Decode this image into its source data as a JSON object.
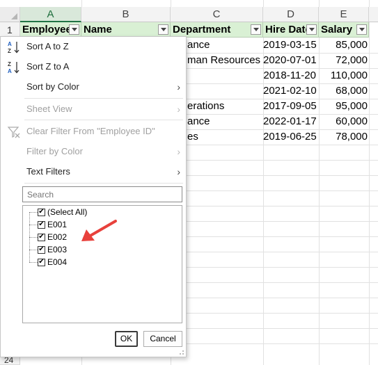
{
  "columns": [
    "A",
    "B",
    "C",
    "D",
    "E"
  ],
  "row_numbers": [
    "1",
    "24"
  ],
  "headers": {
    "employee_id": "Employee I",
    "name": "Name",
    "department": "Department",
    "hire_date": "Hire Date",
    "salary": "Salary"
  },
  "rows": [
    {
      "dept": "ance",
      "date": "2019-03-15",
      "salary": "85,000"
    },
    {
      "dept": "man Resources",
      "date": "2020-07-01",
      "salary": "72,000"
    },
    {
      "dept": "",
      "date": "2018-11-20",
      "salary": "110,000"
    },
    {
      "dept": "",
      "date": "2021-02-10",
      "salary": "68,000"
    },
    {
      "dept": "erations",
      "date": "2017-09-05",
      "salary": "95,000"
    },
    {
      "dept": "ance",
      "date": "2022-01-17",
      "salary": "60,000"
    },
    {
      "dept": "es",
      "date": "2019-06-25",
      "salary": "78,000"
    }
  ],
  "menu": {
    "sort_az": "Sort A to Z",
    "sort_za": "Sort Z to A",
    "sort_by_color": "Sort by Color",
    "sheet_view": "Sheet View",
    "clear_filter": "Clear Filter From \"Employee ID\"",
    "filter_by_color": "Filter by Color",
    "text_filters": "Text Filters",
    "search_placeholder": "Search",
    "select_all": "(Select All)",
    "values": [
      "E001",
      "E002",
      "E003",
      "E004"
    ],
    "ok": "OK",
    "cancel": "Cancel"
  },
  "icons": {
    "sort_az": "sort-ascending-icon",
    "sort_za": "sort-descending-icon",
    "clear_filter": "clear-filter-icon",
    "submenu": "chevron-right-icon"
  },
  "colors": {
    "header_fill": "#d9f0d4",
    "selected_column": "#d9e8da",
    "accent_green": "#217346",
    "annotation_arrow": "#e8413c",
    "sort_icon_blue": "#1f5fbf"
  }
}
